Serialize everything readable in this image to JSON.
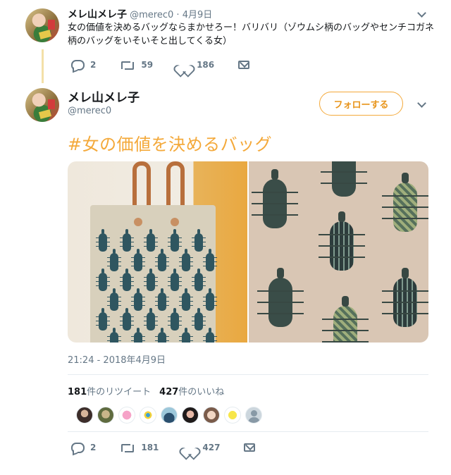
{
  "reply_tweet": {
    "display_name": "メレ山メレ子",
    "handle": "@merec0",
    "separator": "·",
    "date": "4月9日",
    "text": "女の価値を決めるバッグならまかせろー！バリバリ（ゾウムシ柄のバッグやセンチコガネ柄のバッグをいそいそと出してくる女）",
    "actions": {
      "reply_count": "2",
      "retweet_count": "59",
      "like_count": "186"
    }
  },
  "main_tweet": {
    "display_name": "メレ山メレ子",
    "handle": "@merec0",
    "follow_label": "フォローする",
    "hashtag_text": "#女の価値を決めるバッグ",
    "timestamp": "21:24 - 2018年4月9日",
    "stats": {
      "retweet_count": "181",
      "retweet_label": "件のリツイート",
      "like_count": "427",
      "like_label": "件のいいね"
    },
    "liker_count": 9,
    "actions": {
      "reply_count": "2",
      "retweet_count": "181",
      "like_count": "427"
    }
  },
  "colors": {
    "accent": "#f4a93a",
    "muted": "#657786",
    "thread_line": "#f3e0a8"
  },
  "icons": [
    "reply-icon",
    "retweet-icon",
    "like-icon",
    "message-icon",
    "chevron-down-icon"
  ]
}
